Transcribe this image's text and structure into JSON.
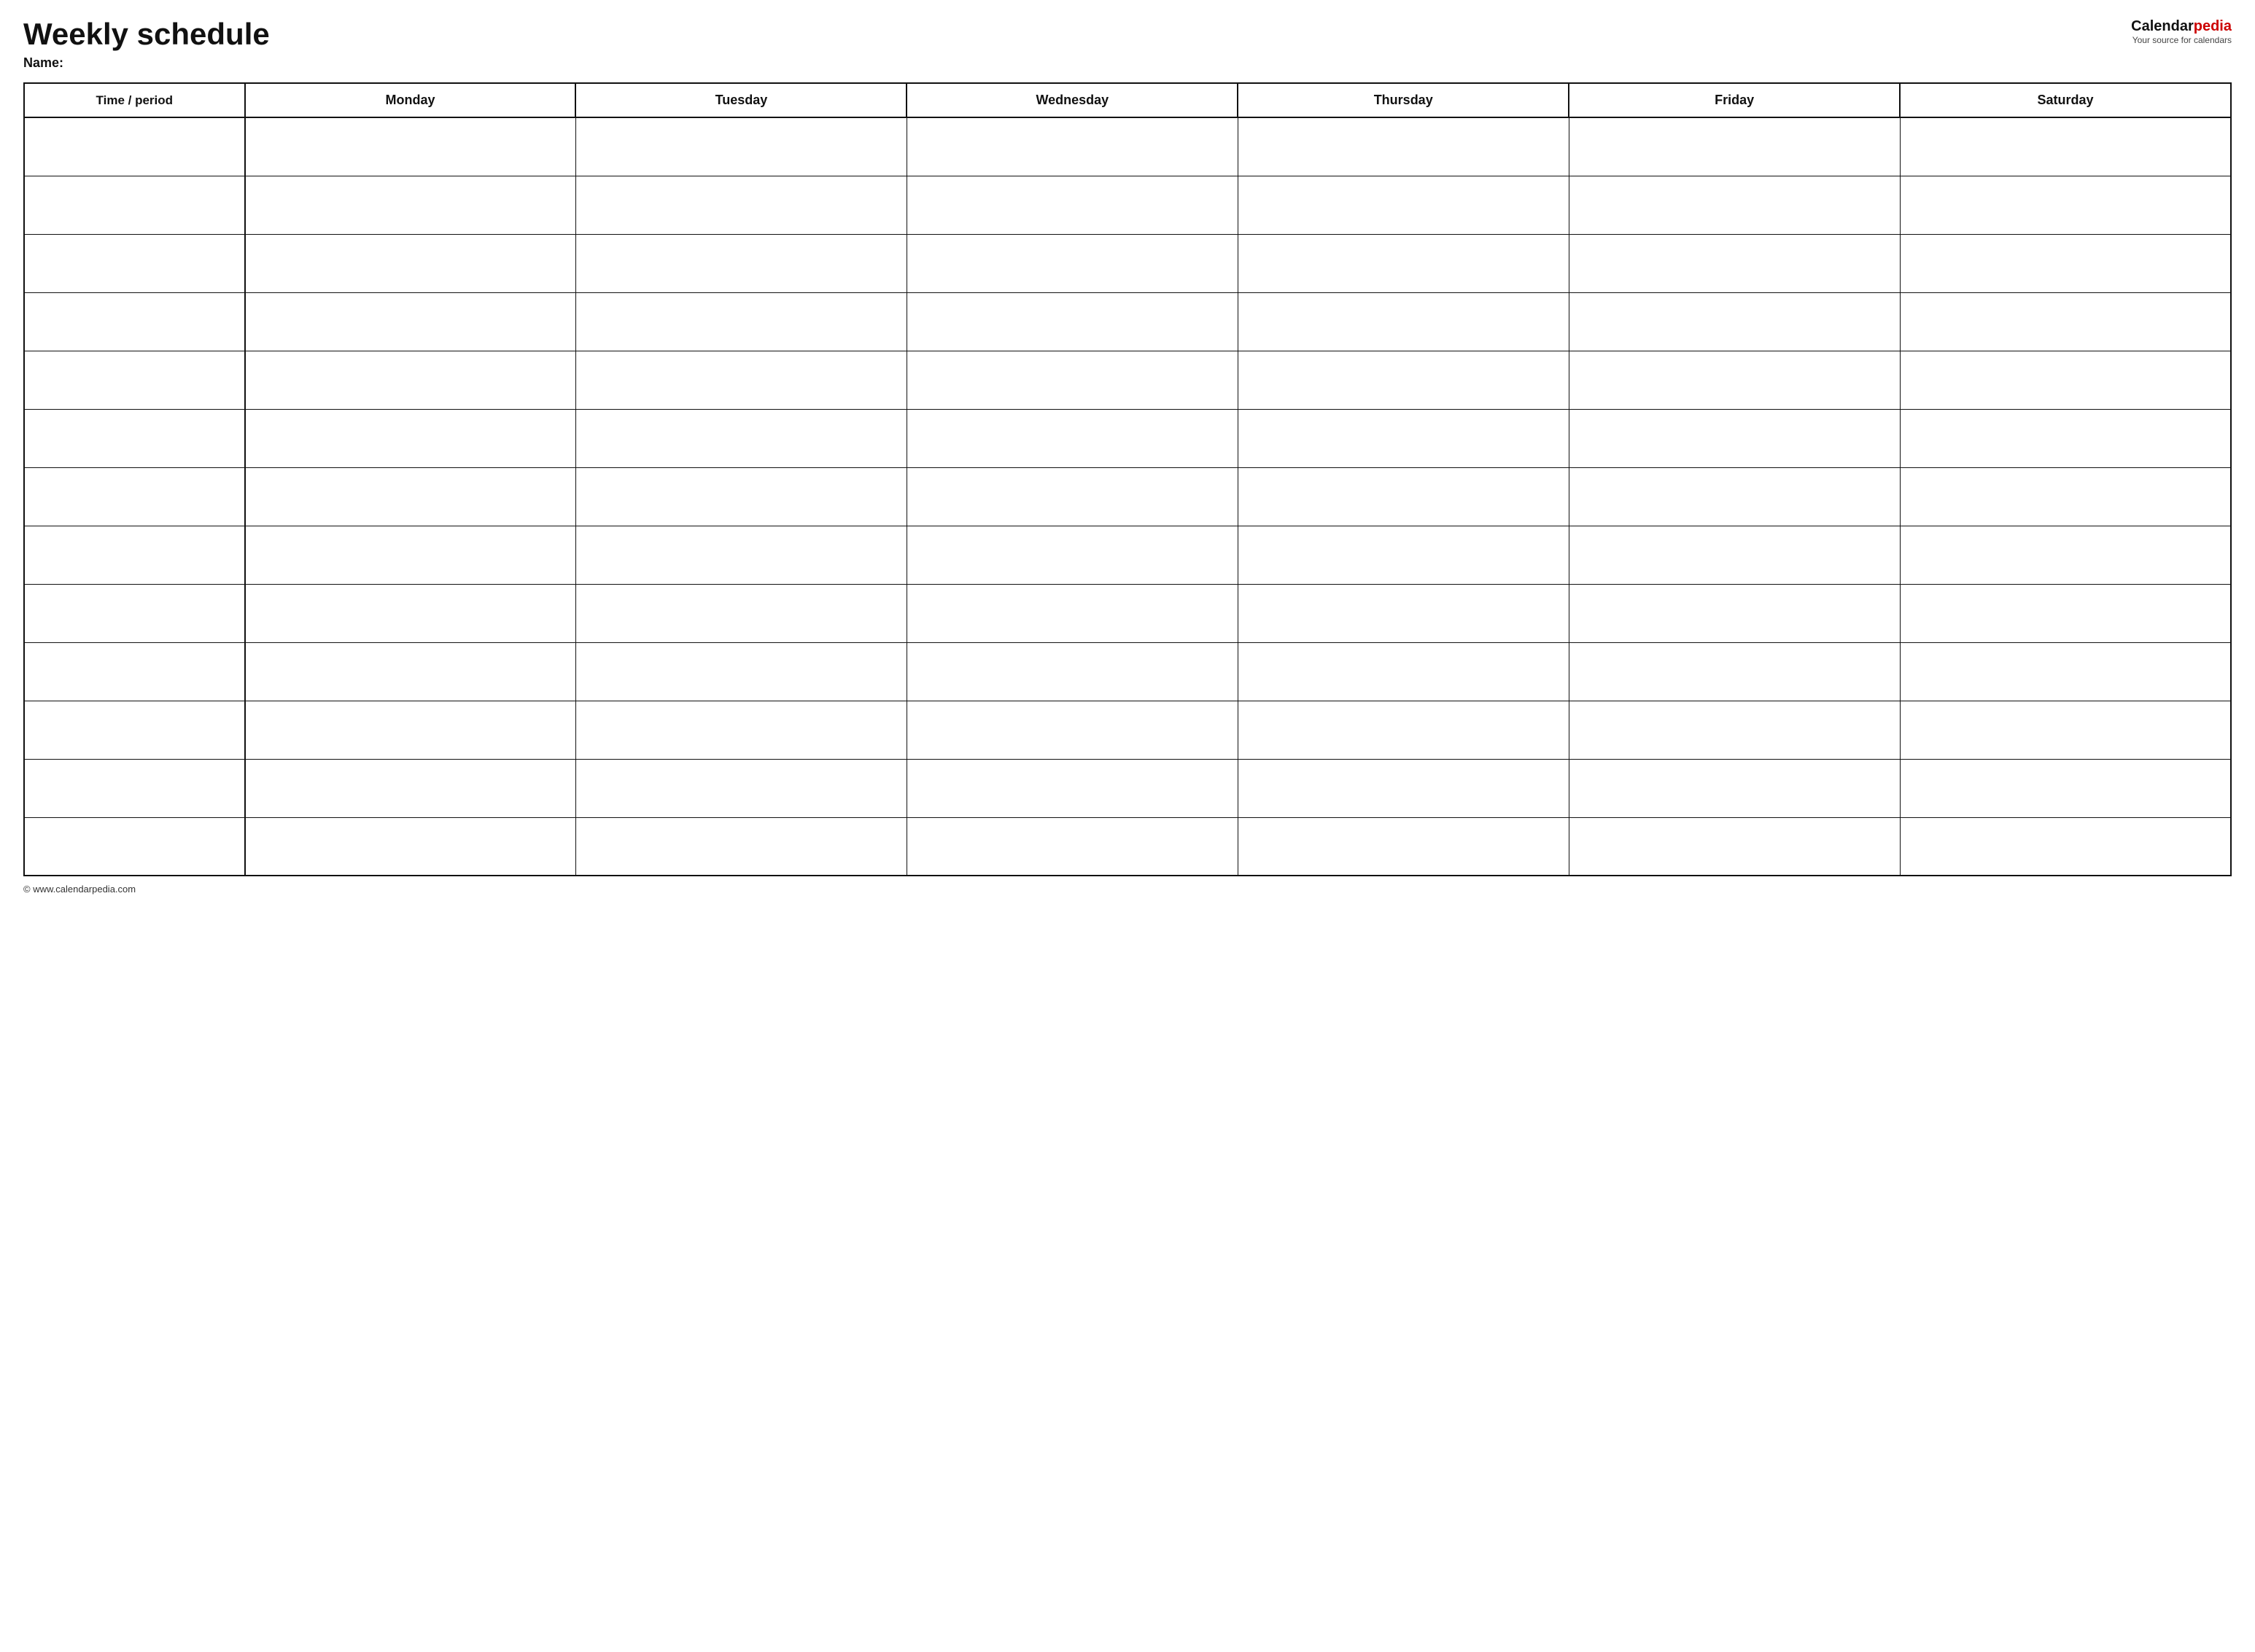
{
  "header": {
    "title": "Weekly schedule",
    "name_label": "Name:",
    "logo_part1": "Calendar",
    "logo_part2": "pedia",
    "logo_tagline": "Your source for calendars"
  },
  "table": {
    "columns": [
      {
        "key": "time",
        "label": "Time / period"
      },
      {
        "key": "monday",
        "label": "Monday"
      },
      {
        "key": "tuesday",
        "label": "Tuesday"
      },
      {
        "key": "wednesday",
        "label": "Wednesday"
      },
      {
        "key": "thursday",
        "label": "Thursday"
      },
      {
        "key": "friday",
        "label": "Friday"
      },
      {
        "key": "saturday",
        "label": "Saturday"
      }
    ],
    "row_count": 13
  },
  "footer": {
    "text": "© www.calendarpedia.com"
  }
}
